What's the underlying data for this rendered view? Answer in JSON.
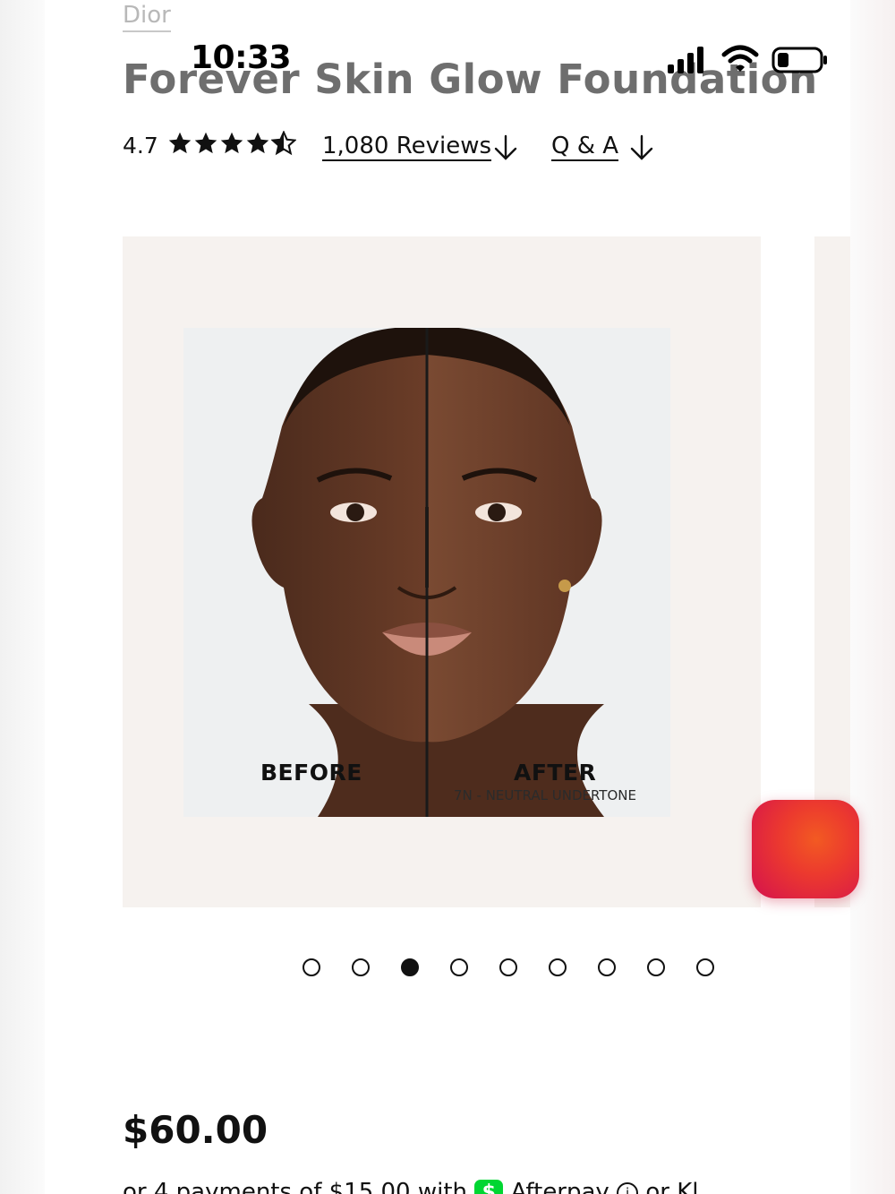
{
  "status_bar": {
    "time": "10:33"
  },
  "product": {
    "brand": "Dior",
    "title": "Forever Skin Glow Foundation",
    "rating": "4.7",
    "stars_filled": 4.5,
    "stars_total": 5,
    "reviews_link": "1,080 Reviews",
    "qa_link": "Q & A"
  },
  "carousel": {
    "before_label": "BEFORE",
    "after_label": "AFTER",
    "shade_label": "7N - NEUTRAL UNDERTONE",
    "dots_total": 9,
    "active_index": 2
  },
  "price": {
    "amount": "$60.00",
    "installments_text": "or 4 payments of $15.00 with",
    "afterpay_label": "Afterpay",
    "or_text": "or",
    "klarna_label": "Kl..."
  },
  "colors": {
    "fab_gradient_start": "#f25a22",
    "fab_gradient_end": "#d4114e",
    "slide_bg": "#f6f2ef"
  }
}
